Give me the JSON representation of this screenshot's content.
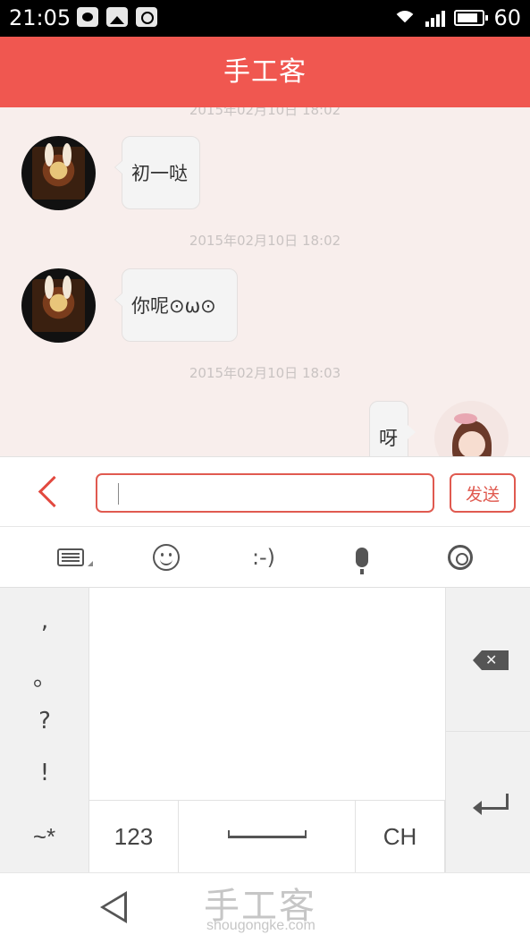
{
  "status_bar": {
    "time": "21:05",
    "battery_level": "60"
  },
  "header": {
    "title": "手工客"
  },
  "chat": {
    "messages": [
      {
        "timestamp": "2015年02月10日 18:02",
        "side": "left",
        "text": "初一哒"
      },
      {
        "timestamp": "2015年02月10日 18:02",
        "side": "left",
        "text": "你呢⊙ω⊙"
      },
      {
        "timestamp": "2015年02月10日 18:03",
        "side": "right",
        "text": "呀"
      }
    ]
  },
  "composer": {
    "input_value": "",
    "send_label": "发送"
  },
  "keyboard": {
    "toolbar": {
      "emoticon_label": ":-)"
    },
    "punctuation": [
      ",",
      "。",
      "?",
      "!"
    ],
    "bottom_row": {
      "symbols": "~*",
      "numbers": "123",
      "lang": "CH"
    }
  },
  "watermark": {
    "logo": "手工客",
    "url": "shougongke.com"
  }
}
